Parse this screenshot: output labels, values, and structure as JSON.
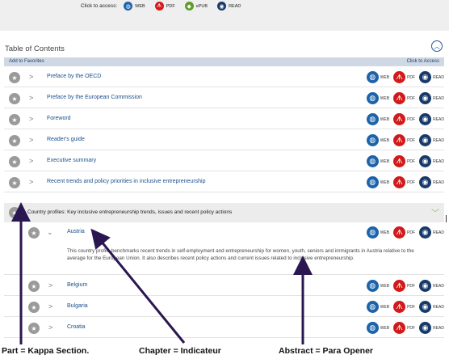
{
  "access_bar": {
    "label": "Click to access:",
    "items": [
      {
        "label": "WEB",
        "icon": "globe-icon",
        "color": "#1d63a9"
      },
      {
        "label": "PDF",
        "icon": "pdf-icon",
        "color": "#d21a1a"
      },
      {
        "label": "ePUB",
        "icon": "epub-icon",
        "color": "#5d9c2c"
      },
      {
        "label": "READ",
        "icon": "eye-icon",
        "color": "#173a6a"
      }
    ]
  },
  "toc": {
    "title": "Table of Contents",
    "add_favorites": "Add to Favorites",
    "click_to_access": "Click to Access",
    "actions": {
      "web": "WEB",
      "pdf": "PDF",
      "read": "READ"
    },
    "rows": [
      {
        "title": "Preface by the OECD"
      },
      {
        "title": "Preface by the European Commission"
      },
      {
        "title": "Foreword"
      },
      {
        "title": "Reader's guide"
      },
      {
        "title": "Executive summary"
      },
      {
        "title": "Recent trends and policy priorities in inclusive entrepreneurship"
      }
    ],
    "part": {
      "title": "Country profiles: Key inclusive entrepreneurship trends, issues and recent policy actions"
    },
    "chapter": {
      "title": "Austria",
      "abstract": "This country profile benchmarks recent trends in self-employment and entrepreneurship for women, youth, seniors and immigrants in Austria relative to the average for the European Union. It also describes recent policy actions and current issues related to inclusive entrepreneurship."
    },
    "countries": [
      {
        "title": "Belgium"
      },
      {
        "title": "Bulgaria"
      },
      {
        "title": "Croatia"
      }
    ]
  },
  "annotations": {
    "part": "Part = Kappa Section.",
    "chapter": "Chapter = Indicateur",
    "abstract": "Abstract = Para Opener"
  },
  "colors": {
    "arrow": "#2a1650",
    "link": "#1a4f8b",
    "header_bar": "#cfd9e6"
  }
}
